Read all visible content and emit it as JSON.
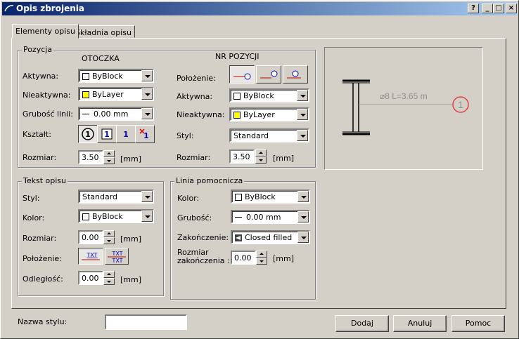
{
  "window": {
    "title": "Opis zbrojenia",
    "help_btn": "?",
    "min_btn": "_",
    "max_btn": "□",
    "close_btn": "×"
  },
  "tabs": [
    {
      "label": "Elementy opisu"
    },
    {
      "label": "Składnia opisu"
    }
  ],
  "pozycja": {
    "title": "Pozycja",
    "otoczka": {
      "header": "OTOCZKA",
      "aktywna_label": "Aktywna:",
      "aktywna_value": "ByBlock",
      "nieaktywna_label": "Nieaktywna:",
      "nieaktywna_value": "ByLayer",
      "grubosc_label": "Grubość linii:",
      "grubosc_value": "0.00 mm",
      "ksztalt_label": "Kształt:",
      "ksztalt_glyph": "1",
      "rozmiar_label": "Rozmiar:",
      "rozmiar_value": "3.50",
      "rozmiar_unit": "[mm]"
    },
    "nr_pozycji": {
      "header": "NR POZYCJI",
      "polozenie_label": "Położenie:",
      "aktywna_label": "Aktywna:",
      "aktywna_value": "ByBlock",
      "nieaktywna_label": "Nieaktywna:",
      "nieaktywna_value": "ByLayer",
      "styl_label": "Styl:",
      "styl_value": "Standard",
      "rozmiar_label": "Rozmiar:",
      "rozmiar_value": "3.50",
      "rozmiar_unit": "[mm]"
    }
  },
  "tekst_opisu": {
    "title": "Tekst opisu",
    "styl_label": "Styl:",
    "styl_value": "Standard",
    "kolor_label": "Kolor:",
    "kolor_value": "ByBlock",
    "rozmiar_label": "Rozmiar:",
    "rozmiar_value": "0.00",
    "rozmiar_unit": "[mm]",
    "polozenie_label": "Położenie:",
    "txt_glyph": "TXT",
    "odleglosc_label": "Odległość:",
    "odleglosc_value": "0.00",
    "odleglosc_unit": "[mm]"
  },
  "linia_pomocnicza": {
    "title": "Linia pomocnicza",
    "kolor_label": "Kolor:",
    "kolor_value": "ByBlock",
    "grubosc_label": "Grubość:",
    "grubosc_value": "0.00 mm",
    "zakonczenie_label": "Zakończenie:",
    "zakonczenie_value": "Closed filled",
    "rozmiar_zak_label_1": "Rozmiar",
    "rozmiar_zak_label_2": "zakończenia :",
    "rozmiar_zak_value": "0.00",
    "rozmiar_zak_unit": "[mm]"
  },
  "preview": {
    "label": "⌀8  L=3.65 m",
    "marker": "1"
  },
  "footer": {
    "nazwa_label": "Nazwa stylu:",
    "nazwa_value": "",
    "dodaj": "Dodaj",
    "anuluj": "Anuluj",
    "pomoc": "Pomoc"
  },
  "colors": {
    "yellow_swatch": "#ffff00",
    "title_bar": "#0a246a",
    "marker": "#e04040"
  }
}
